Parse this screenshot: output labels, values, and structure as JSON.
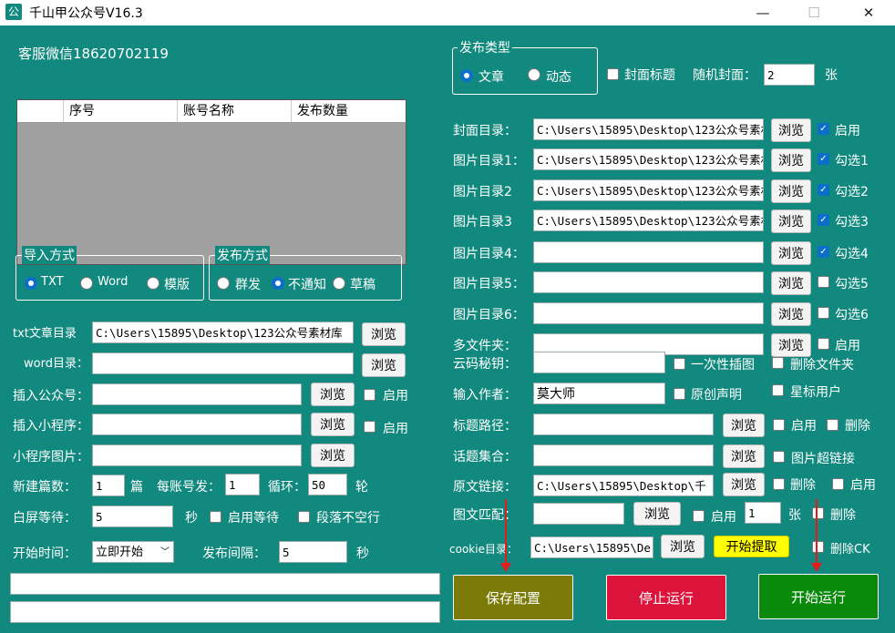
{
  "window": {
    "title": "千山甲公众号V16.3",
    "icon_text": "公",
    "min": "—",
    "max": "☐",
    "close": "✕"
  },
  "left": {
    "service": "客服微信18620702119",
    "grid_columns": [
      "序号",
      "账号名称",
      "发布数量"
    ],
    "import_group": "导入方式",
    "import_options": [
      "TXT",
      "Word",
      "模版"
    ],
    "publish_mode_group": "发布方式",
    "publish_mode_options": [
      "群发",
      "不通知",
      "草稿"
    ],
    "txt_label": "txt文章目录",
    "txt_value": "C:\\Users\\15895\\Desktop\\123公众号素材库",
    "word_label": "word目录：",
    "word_value": "",
    "insert_gzh_label": "插入公众号：",
    "insert_mini_label": "插入小程序：",
    "mini_img_label": "小程序图片：",
    "browse": "浏览",
    "enable": "启用",
    "new_count_label": "新建篇数：",
    "new_count_value": "1",
    "unit_pian": "篇",
    "per_account_label": "每账号发：",
    "per_account_value": "1",
    "loop_label": "循环：",
    "loop_value": "50",
    "unit_lun": "轮",
    "white_wait_label": "白屏等待：",
    "white_wait_value": "5",
    "unit_sec": "秒",
    "enable_wait": "启用等待",
    "no_blank_line": "段落不空行",
    "start_time_label": "开始时间：",
    "start_time_value": "立即开始",
    "interval_label": "发布间隔：",
    "interval_value": "5"
  },
  "right": {
    "type_group": "发布类型",
    "type_options": [
      "文章",
      "动态"
    ],
    "cover_title": "封面标题",
    "random_cover_label": "随机封面：",
    "random_cover_value": "2",
    "unit_zhang": "张",
    "rows": [
      {
        "label": "封面目录：",
        "value": "C:\\Users\\15895\\Desktop\\123公众号素材",
        "check": "启用",
        "checked": true
      },
      {
        "label": "图片目录1：",
        "value": "C:\\Users\\15895\\Desktop\\123公众号素材",
        "check": "勾选1",
        "checked": true
      },
      {
        "label": "图片目录2",
        "value": "C:\\Users\\15895\\Desktop\\123公众号素材",
        "check": "勾选2",
        "checked": true
      },
      {
        "label": "图片目录3",
        "value": "C:\\Users\\15895\\Desktop\\123公众号素材",
        "check": "勾选3",
        "checked": true
      },
      {
        "label": "图片目录4：",
        "value": "",
        "check": "勾选4",
        "checked": true
      },
      {
        "label": "图片目录5：",
        "value": "",
        "check": "勾选5",
        "checked": false
      },
      {
        "label": "图片目录6：",
        "value": "",
        "check": "勾选6",
        "checked": false
      },
      {
        "label": "多文件夹：",
        "value": "",
        "check": "启用",
        "checked": false
      }
    ],
    "browse": "浏览",
    "cloud_key_label": "云码秘钥：",
    "one_time_insert": "一次性插图",
    "delete_folder": "删除文件夹",
    "author_label": "输入作者：",
    "author_value": "莫大师",
    "original": "原创声明",
    "star_user": "星标用户",
    "title_path_label": "标题路径：",
    "enable": "启用",
    "delete": "删除",
    "topic_label": "话题集合：",
    "img_hyperlink": "图片超链接",
    "orig_link_label": "原文链接：",
    "orig_link_value": "C:\\Users\\15895\\Desktop\\千",
    "img_match_label": "图文匹配：",
    "img_match_count": "1",
    "cookie_label": "cookie目录：",
    "cookie_value": "C:\\Users\\15895\\De",
    "extract_btn": "开始提取",
    "delete_ck": "删除CK",
    "save_btn": "保存配置",
    "stop_btn": "停止运行",
    "start_btn": "开始运行"
  },
  "colors": {
    "bg": "#11897e",
    "save": "#7b7b0a",
    "stop": "#dc143c",
    "start": "#0a8a0a",
    "extract": "#ffff00",
    "accent": "#0b6fc9"
  }
}
